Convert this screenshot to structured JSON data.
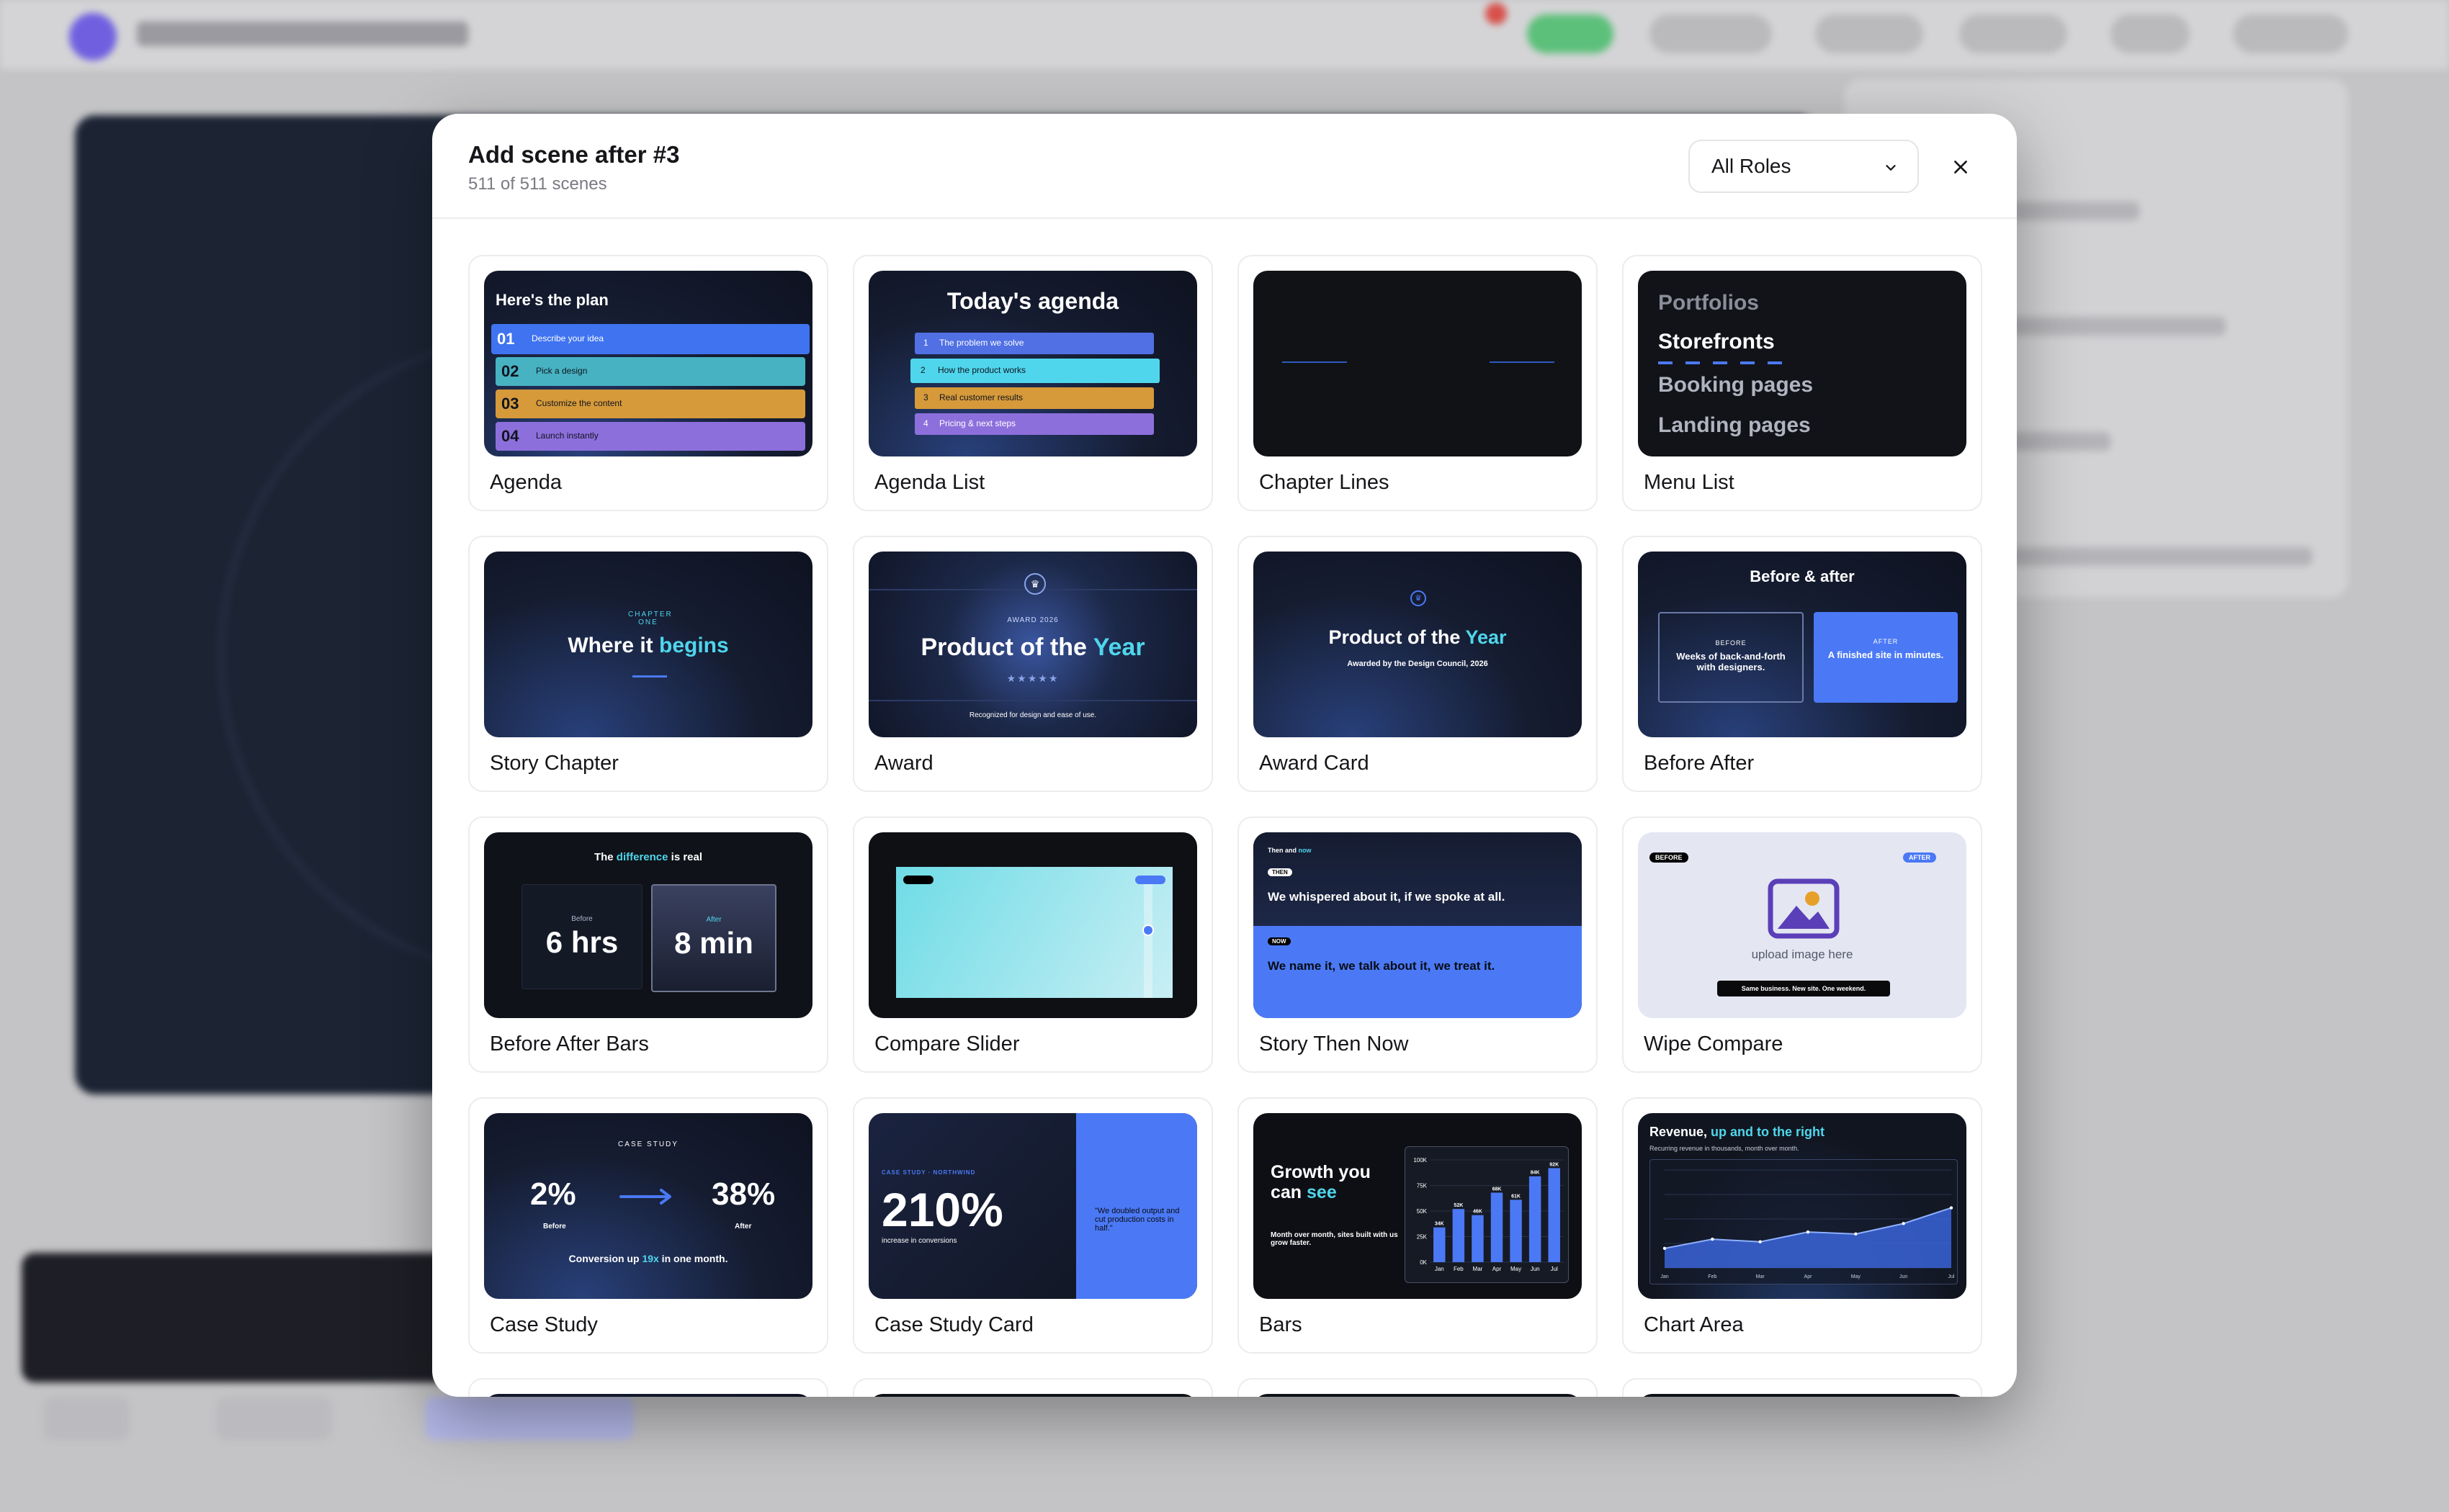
{
  "modal": {
    "title": "Add scene after #3",
    "subtitle": "511 of 511 scenes",
    "role_filter": "All Roles",
    "close_icon": "close-icon"
  },
  "cards": [
    {
      "label": "Agenda",
      "preview": {
        "title": "Here's the plan",
        "items": [
          {
            "num": "01",
            "text": "Describe your idea",
            "color": "#3f73f0"
          },
          {
            "num": "02",
            "text": "Pick a design",
            "color": "#47b2c2"
          },
          {
            "num": "03",
            "text": "Customize the content",
            "color": "#d69a3a"
          },
          {
            "num": "04",
            "text": "Launch instantly",
            "color": "#8d6fdc"
          }
        ]
      }
    },
    {
      "label": "Agenda List",
      "preview": {
        "title": "Today's agenda",
        "items": [
          {
            "num": "1",
            "text": "The problem we solve",
            "color": "#5070e4"
          },
          {
            "num": "2",
            "text": "How the product works",
            "color": "#4fd6ec"
          },
          {
            "num": "3",
            "text": "Real customer results",
            "color": "#d69a3a"
          },
          {
            "num": "4",
            "text": "Pricing & next steps",
            "color": "#8d6fdc"
          }
        ]
      }
    },
    {
      "label": "Chapter Lines",
      "preview": {}
    },
    {
      "label": "Menu List",
      "preview": {
        "items": [
          "Portfolios",
          "Storefronts",
          "Booking pages",
          "Landing pages"
        ]
      }
    },
    {
      "label": "Story Chapter",
      "preview": {
        "kicker": "CHAPTER ONE",
        "title_a": "Where it ",
        "title_b": "begins"
      }
    },
    {
      "label": "Award",
      "preview": {
        "kicker": "AWARD 2026",
        "title_a": "Product of the ",
        "title_b": "Year",
        "stars": "★★★★★",
        "caption": "Recognized for design and ease of use."
      }
    },
    {
      "label": "Award Card",
      "preview": {
        "title_a": "Product of the ",
        "title_b": "Year",
        "caption": "Awarded by the Design Council, 2026"
      }
    },
    {
      "label": "Before After",
      "preview": {
        "title": "Before & after",
        "before_tag": "BEFORE",
        "before_text": "Weeks of back-and-forth with designers.",
        "after_tag": "AFTER",
        "after_text": "A finished site in minutes."
      }
    },
    {
      "label": "Before After Bars",
      "preview": {
        "title_a": "The ",
        "title_b": "difference",
        "title_c": " is real",
        "before_tag": "Before",
        "before_value": "6 hrs",
        "after_tag": "After",
        "after_value": "8 min"
      }
    },
    {
      "label": "Compare Slider",
      "preview": {}
    },
    {
      "label": "Story Then Now",
      "preview": {
        "head_a": "Then and ",
        "head_b": "now",
        "then_tag": "THEN",
        "then_text": "We whispered about it, if we spoke at all.",
        "now_tag": "NOW",
        "now_text": "We name it, we talk about it, we treat it."
      }
    },
    {
      "label": "Wipe Compare",
      "preview": {
        "before_tag": "BEFORE",
        "after_tag": "AFTER",
        "upload_text": "upload image here",
        "caption": "Same business. New site. One weekend."
      }
    },
    {
      "label": "Case Study",
      "preview": {
        "kicker": "CASE STUDY",
        "before_value": "2%",
        "before_tag": "Before",
        "after_value": "38%",
        "after_tag": "After",
        "caption_a": "Conversion up ",
        "caption_b": "19x",
        "caption_c": " in one month."
      }
    },
    {
      "label": "Case Study Card",
      "preview": {
        "kicker": "CASE STUDY · NORTHWIND",
        "value": "210%",
        "caption": "increase in conversions",
        "quote": "\"We doubled output and cut production costs in half.\""
      }
    },
    {
      "label": "Bars",
      "preview": {
        "title_a": "Growth you can ",
        "title_b": "see",
        "caption": "Month over month, sites built with us grow faster."
      }
    },
    {
      "label": "Chart Area",
      "preview": {
        "title_a": "Revenue, ",
        "title_b": "up and to the right",
        "caption": "Recurring revenue in thousands, month over month."
      }
    }
  ],
  "bars_chart": {
    "type": "bar",
    "categories": [
      "Jan",
      "Feb",
      "Mar",
      "Apr",
      "May",
      "Jun",
      "Jul"
    ],
    "values": [
      34,
      52,
      46,
      68,
      61,
      84,
      92
    ],
    "value_labels": [
      "34K",
      "52K",
      "46K",
      "68K",
      "61K",
      "84K",
      "92K"
    ],
    "yticks": [
      "0K",
      "25K",
      "50K",
      "75K",
      "100K"
    ],
    "ylim": [
      0,
      100
    ]
  },
  "area_chart": {
    "type": "area",
    "categories": [
      "Jan",
      "Feb",
      "Mar",
      "Apr",
      "May",
      "Jun",
      "Jul"
    ],
    "values": [
      30,
      44,
      40,
      55,
      52,
      68,
      92
    ],
    "ylim": [
      0,
      150
    ]
  },
  "colors": {
    "accent": "#4b79f5",
    "cyan": "#4fd6ec",
    "navy": "#151c30"
  }
}
